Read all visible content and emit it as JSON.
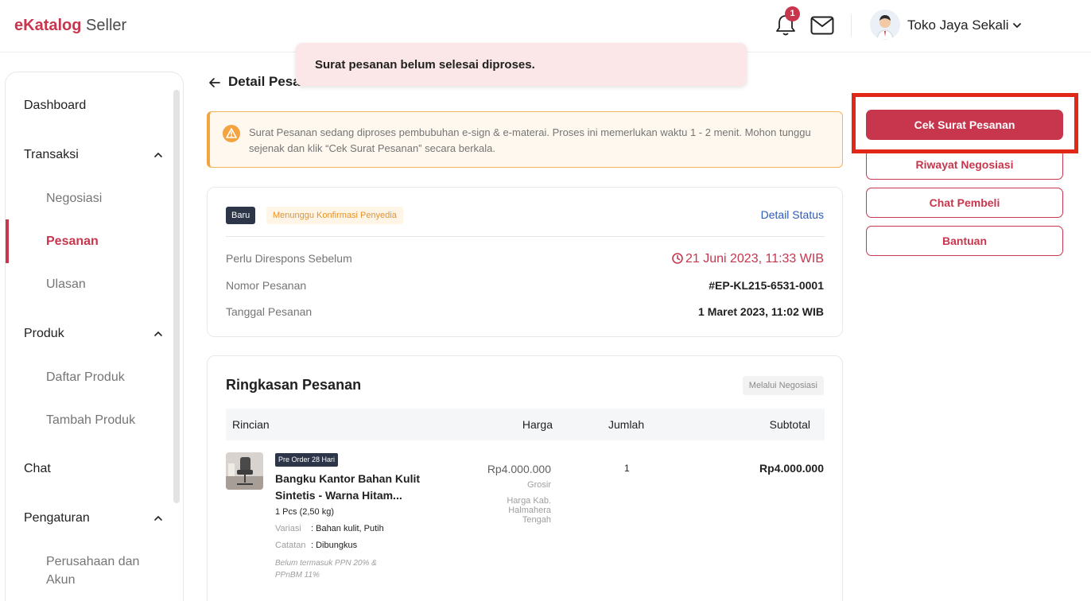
{
  "header": {
    "logo_brand": "eKatalog",
    "logo_sub": "Seller",
    "notification_count": "1",
    "store_name": "Toko Jaya Sekali"
  },
  "sidebar": {
    "items": [
      {
        "label": "Dashboard"
      },
      {
        "label": "Transaksi",
        "children": [
          {
            "label": "Negosiasi"
          },
          {
            "label": "Pesanan",
            "active": true
          },
          {
            "label": "Ulasan"
          }
        ]
      },
      {
        "label": "Produk",
        "children": [
          {
            "label": "Daftar Produk"
          },
          {
            "label": "Tambah Produk"
          }
        ]
      },
      {
        "label": "Chat"
      },
      {
        "label": "Pengaturan",
        "children": [
          {
            "label": "Perusahaan dan Akun"
          }
        ]
      }
    ]
  },
  "toast": {
    "message": "Surat pesanan belum selesai diproses."
  },
  "page": {
    "title": "Detail Pesanan"
  },
  "alert": {
    "text": "Surat Pesanan sedang diproses pembubuhan e-sign & e-materai. Proses ini memerlukan waktu 1 - 2 menit. Mohon tunggu sejenak dan klik “Cek Surat Pesanan” secara berkala."
  },
  "status": {
    "badge_new": "Baru",
    "badge_state": "Menunggu Konfirmasi Penyedia",
    "detail_link": "Detail Status",
    "rows": [
      {
        "label": "Perlu Direspons Sebelum",
        "value": "21 Juni 2023, 11:33 WIB"
      },
      {
        "label": "Nomor Pesanan",
        "value": "#EP-KL215-6531-0001"
      },
      {
        "label": "Tanggal Pesanan",
        "value": "1 Maret 2023, 11:02 WIB"
      }
    ]
  },
  "summary": {
    "title": "Ringkasan Pesanan",
    "via": "Melalui Negosiasi",
    "columns": [
      "Rincian",
      "Harga",
      "Jumlah",
      "Subtotal"
    ],
    "item": {
      "preorder": "Pre Order 28 Hari",
      "name": "Bangku Kantor Bahan Kulit Sintetis - Warna Hitam...",
      "qty_weight": "1 Pcs (2,50 kg)",
      "variant_label": "Variasi",
      "variant_value": ": Bahan kulit, Putih",
      "note_label": "Catatan",
      "note_value": ": Dibungkus",
      "tax_note": "Belum termasuk PPN 20% & PPnBM 11%",
      "price": "Rp4.000.000",
      "price_type": "Grosir",
      "price_region": "Harga Kab. Halmahera Tengah",
      "quantity": "1",
      "subtotal": "Rp4.000.000"
    }
  },
  "actions": {
    "check_order": "Cek Surat Pesanan",
    "negotiation_history": "Riwayat Negosiasi",
    "chat_buyer": "Chat Pembeli",
    "help": "Bantuan"
  },
  "colors": {
    "brand": "#c8364e",
    "highlight": "#e02718",
    "link": "#2e5bb5",
    "warning": "#f3a340"
  }
}
